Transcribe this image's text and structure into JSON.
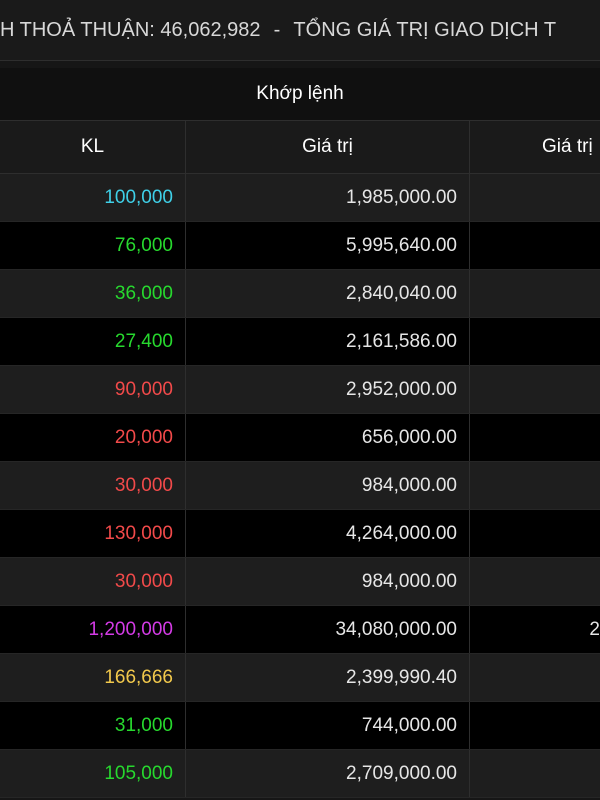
{
  "header": {
    "summary_left": "H THOẢ THUẬN: 46,062,982",
    "separator": "-",
    "summary_right": "TỔNG GIÁ TRỊ GIAO DỊCH T"
  },
  "table": {
    "group_label": "Khớp lệnh",
    "columns": [
      "KL",
      "Giá trị",
      "Giá trị"
    ],
    "colors": {
      "cyan": "#3fd0e8",
      "green": "#27d92e",
      "red": "#f24a4a",
      "purple": "#d43be6",
      "yellow": "#f2c94c"
    },
    "rows": [
      {
        "kl": "100,000",
        "value": "1,985,000.00",
        "extra": "",
        "kl_color": "cyan"
      },
      {
        "kl": "76,000",
        "value": "5,995,640.00",
        "extra": "",
        "kl_color": "green"
      },
      {
        "kl": "36,000",
        "value": "2,840,040.00",
        "extra": "",
        "kl_color": "green"
      },
      {
        "kl": "27,400",
        "value": "2,161,586.00",
        "extra": "",
        "kl_color": "green"
      },
      {
        "kl": "90,000",
        "value": "2,952,000.00",
        "extra": "",
        "kl_color": "red"
      },
      {
        "kl": "20,000",
        "value": "656,000.00",
        "extra": "",
        "kl_color": "red"
      },
      {
        "kl": "30,000",
        "value": "984,000.00",
        "extra": "",
        "kl_color": "red"
      },
      {
        "kl": "130,000",
        "value": "4,264,000.00",
        "extra": "",
        "kl_color": "red"
      },
      {
        "kl": "30,000",
        "value": "984,000.00",
        "extra": "",
        "kl_color": "red"
      },
      {
        "kl": "1,200,000",
        "value": "34,080,000.00",
        "extra": "2",
        "kl_color": "purple"
      },
      {
        "kl": "166,666",
        "value": "2,399,990.40",
        "extra": "",
        "kl_color": "yellow"
      },
      {
        "kl": "31,000",
        "value": "744,000.00",
        "extra": "",
        "kl_color": "green"
      },
      {
        "kl": "105,000",
        "value": "2,709,000.00",
        "extra": "",
        "kl_color": "green"
      }
    ]
  }
}
